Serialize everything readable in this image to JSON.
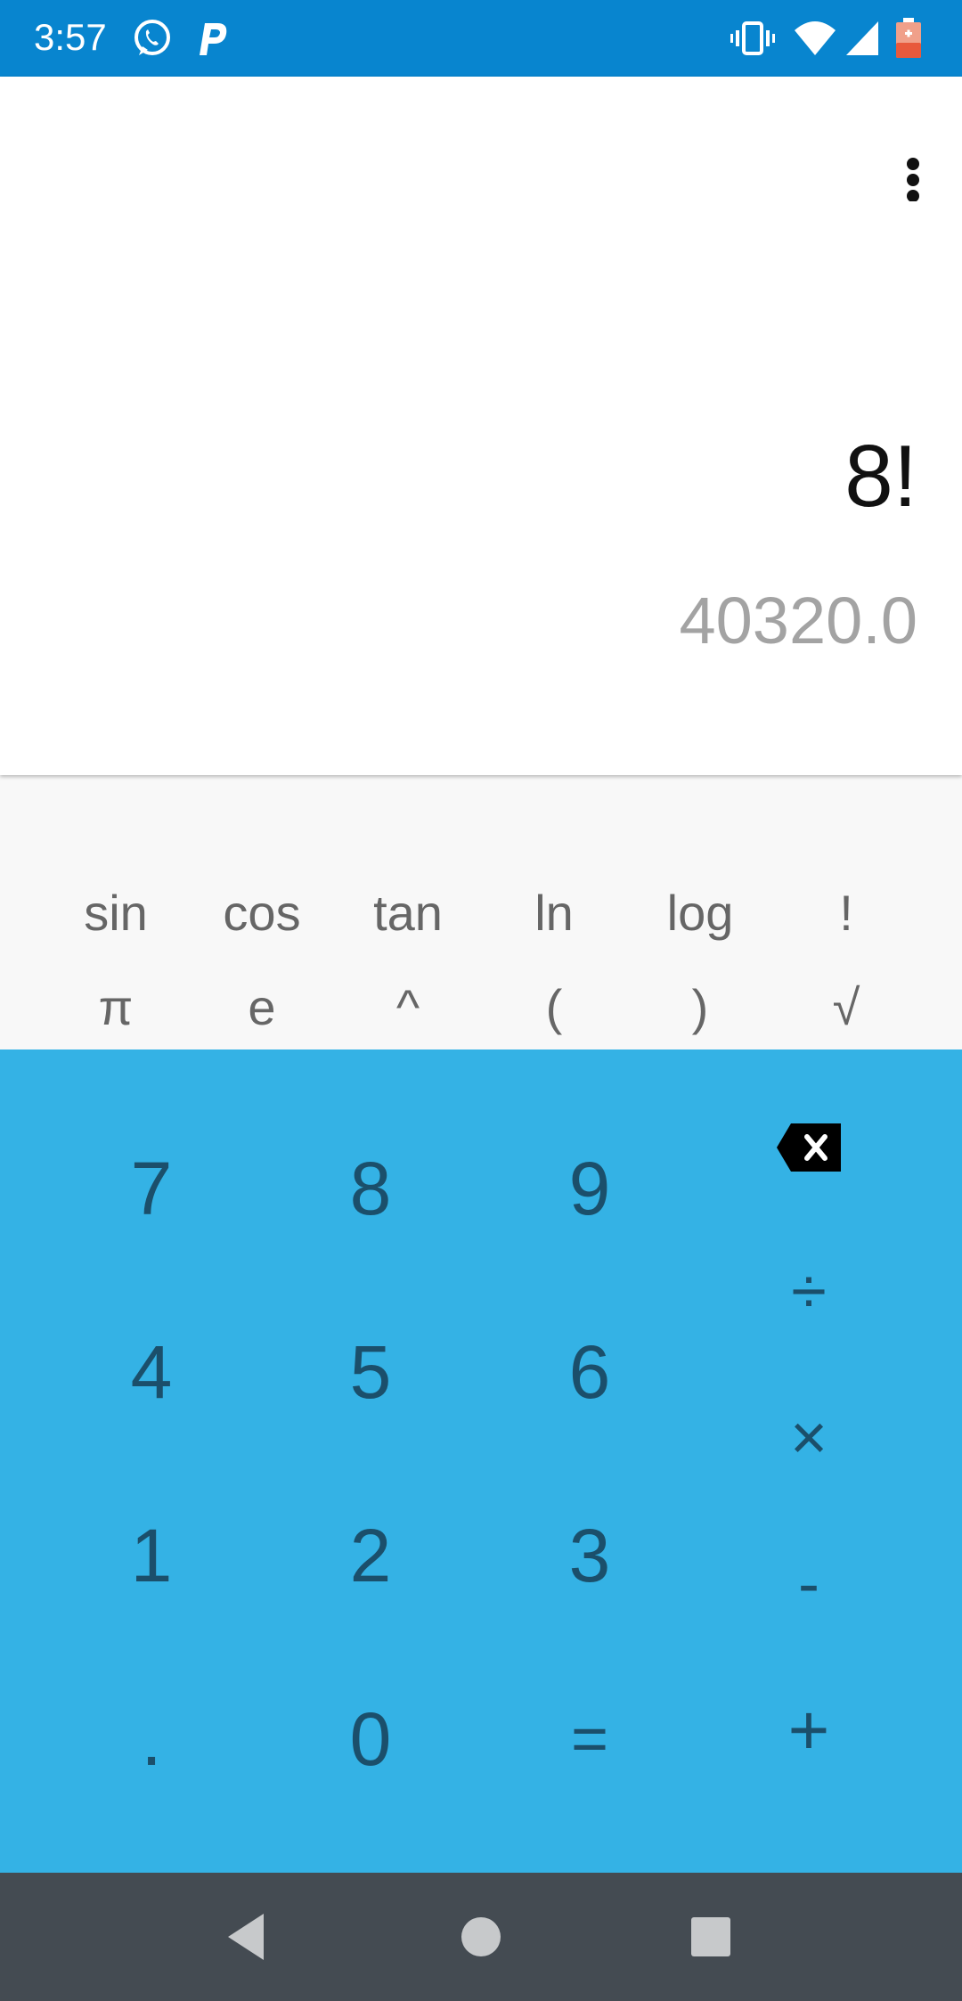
{
  "status_bar": {
    "time": "3:57",
    "left_icons": [
      "whatsapp-icon",
      "p-app-icon"
    ],
    "right_icons": [
      "vibrate-icon",
      "wifi-icon",
      "signal-icon",
      "battery-icon"
    ],
    "background_color": "#0885cf"
  },
  "display": {
    "menu_icon": "more-vert-icon",
    "expression": "8!",
    "result": "40320.0"
  },
  "advanced_pad": {
    "row1": [
      "sin",
      "cos",
      "tan",
      "ln",
      "log",
      "!"
    ],
    "row2": [
      "π",
      "e",
      "^",
      "(",
      ")",
      "√"
    ],
    "background_color": "#f8f8f8"
  },
  "numeric_pad": {
    "digits": {
      "d7": "7",
      "d8": "8",
      "d9": "9",
      "d4": "4",
      "d5": "5",
      "d6": "6",
      "d1": "1",
      "d2": "2",
      "d3": "3",
      "dot": ".",
      "d0": "0",
      "equals": "="
    },
    "operators": {
      "delete_icon": "backspace-icon",
      "divide": "÷",
      "multiply": "×",
      "minus": "-",
      "plus": "+"
    },
    "background_color": "#34b2e5",
    "text_color": "#1b4f6b"
  },
  "nav_bar": {
    "buttons": [
      "back-icon",
      "home-icon",
      "recents-icon"
    ],
    "background_color": "#444b52"
  }
}
